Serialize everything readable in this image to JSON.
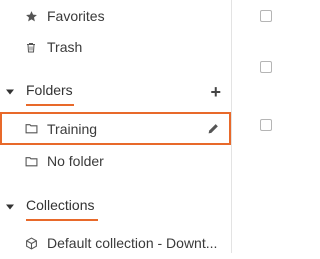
{
  "sidebar": {
    "favorites": {
      "label": "Favorites",
      "icon": "star-icon"
    },
    "trash": {
      "label": "Trash",
      "icon": "trash-icon"
    },
    "folders": {
      "title": "Folders",
      "add_icon": "plus-icon",
      "items": [
        {
          "label": "Training",
          "icon": "folder-icon",
          "selected": true
        },
        {
          "label": "No folder",
          "icon": "folder-icon"
        }
      ]
    },
    "collections": {
      "title": "Collections",
      "items": [
        {
          "label": "Default collection - Downt...",
          "icon": "cube-icon"
        }
      ]
    }
  },
  "colors": {
    "accent": "#e8692a"
  }
}
